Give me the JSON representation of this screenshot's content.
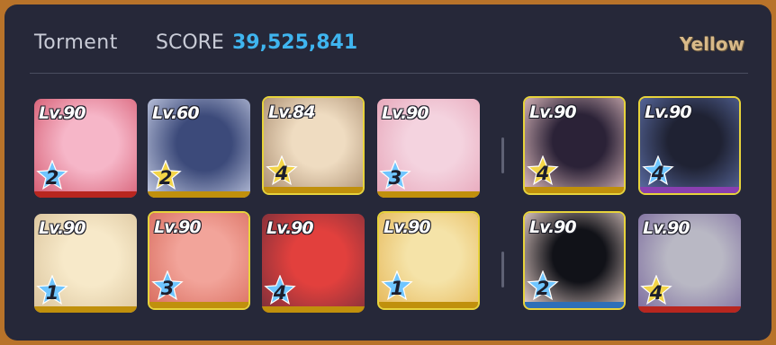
{
  "header": {
    "difficulty": "Torment",
    "score_label": "SCORE",
    "score_value": "39,525,841",
    "armor": "Yellow"
  },
  "colors": {
    "border": "#b8732a",
    "panel": "#262839",
    "score": "#3fb5ef",
    "armor": "#d8b988",
    "frame": "#e7d33b",
    "star_blue": "#6fc5ff",
    "star_gold": "#f3d548",
    "bar_red": "#b8261f",
    "bar_gold": "#c0900c",
    "bar_purple": "#8a3fb0",
    "bar_blue": "#2e6fb8"
  },
  "strikers": [
    {
      "level": "Lv.90",
      "star": "2",
      "star_color": "blue",
      "bar": "red",
      "framed": false,
      "portrait": [
        "#f6b6c8",
        "#d4586e"
      ]
    },
    {
      "level": "Lv.60",
      "star": "2",
      "star_color": "gold",
      "bar": "gold",
      "framed": false,
      "portrait": [
        "#3c4a7a",
        "#c8cfe6"
      ]
    },
    {
      "level": "Lv.84",
      "star": "4",
      "star_color": "gold",
      "bar": "gold",
      "framed": true,
      "portrait": [
        "#efdcc1",
        "#a88b6e"
      ]
    },
    {
      "level": "Lv.90",
      "star": "3",
      "star_color": "blue",
      "bar": "gold",
      "framed": false,
      "portrait": [
        "#f4d3df",
        "#e6a2b6"
      ]
    },
    {
      "level": "Lv.90",
      "star": "1",
      "star_color": "blue",
      "bar": "gold",
      "framed": false,
      "portrait": [
        "#f7e9c9",
        "#d9c29a"
      ]
    },
    {
      "level": "Lv.90",
      "star": "3",
      "star_color": "blue",
      "bar": "gold",
      "framed": true,
      "portrait": [
        "#f2a49a",
        "#d86b5c"
      ]
    },
    {
      "level": "Lv.90",
      "star": "4",
      "star_color": "blue",
      "bar": "gold",
      "framed": false,
      "portrait": [
        "#e2403d",
        "#7a2f3a"
      ]
    },
    {
      "level": "Lv.90",
      "star": "1",
      "star_color": "blue",
      "bar": "gold",
      "framed": true,
      "portrait": [
        "#f5e3a8",
        "#e6b859"
      ]
    }
  ],
  "specials": [
    {
      "level": "Lv.90",
      "star": "4",
      "star_color": "gold",
      "bar": "gold",
      "framed": true,
      "portrait": [
        "#2b2237",
        "#e9c4c6"
      ]
    },
    {
      "level": "Lv.90",
      "star": "4",
      "star_color": "blue",
      "bar": "purple",
      "framed": true,
      "portrait": [
        "#1f2233",
        "#5d6fa8"
      ]
    },
    {
      "level": "Lv.90",
      "star": "2",
      "star_color": "blue",
      "bar": "blue",
      "framed": true,
      "portrait": [
        "#111218",
        "#f0d8d2"
      ]
    },
    {
      "level": "Lv.90",
      "star": "4",
      "star_color": "gold",
      "bar": "red",
      "framed": false,
      "portrait": [
        "#b9b8c4",
        "#7b6a9e"
      ]
    }
  ]
}
